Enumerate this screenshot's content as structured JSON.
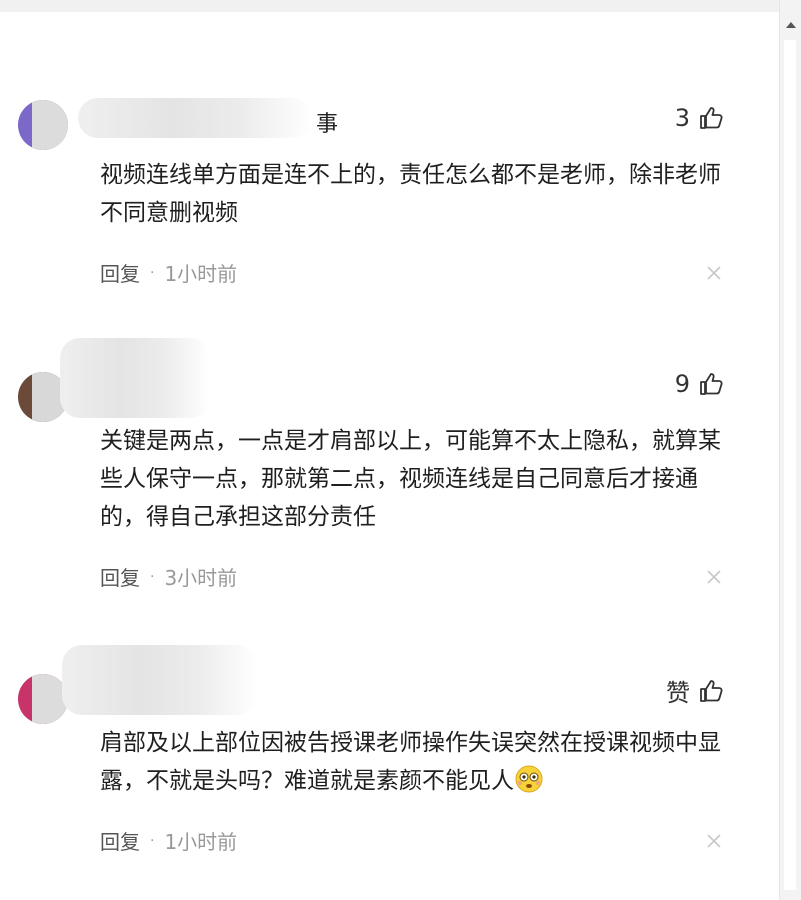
{
  "comments": [
    {
      "name_tail": "事",
      "likes": "3",
      "text": "视频连线单方面是连不上的，责任怎么都不是老师，除非老师不同意删视频",
      "reply_label": "回复",
      "time": "1小时前",
      "avatar_color": "#7b68c8"
    },
    {
      "name_tail": "",
      "likes": "9",
      "text": "关键是两点，一点是才肩部以上，可能算不太上隐私，就算某些人保守一点，那就第二点，视频连线是自己同意后才接通的，得自己承担这部分责任",
      "reply_label": "回复",
      "time": "3小时前",
      "avatar_color": "#6b4a3a"
    },
    {
      "name_tail": "",
      "likes": "赞",
      "text": "肩部及以上部位因被告授课老师操作失误突然在授课视频中显露，不就是头吗？难道就是素颜不能见人",
      "reply_label": "回复",
      "time": "1小时前",
      "avatar_color": "#c8336a",
      "emoji": "flushed-face-emoji"
    }
  ],
  "icons": {
    "like": "thumbs-up-icon",
    "close": "close-icon",
    "scroll_up": "scroll-up-arrow-icon"
  }
}
